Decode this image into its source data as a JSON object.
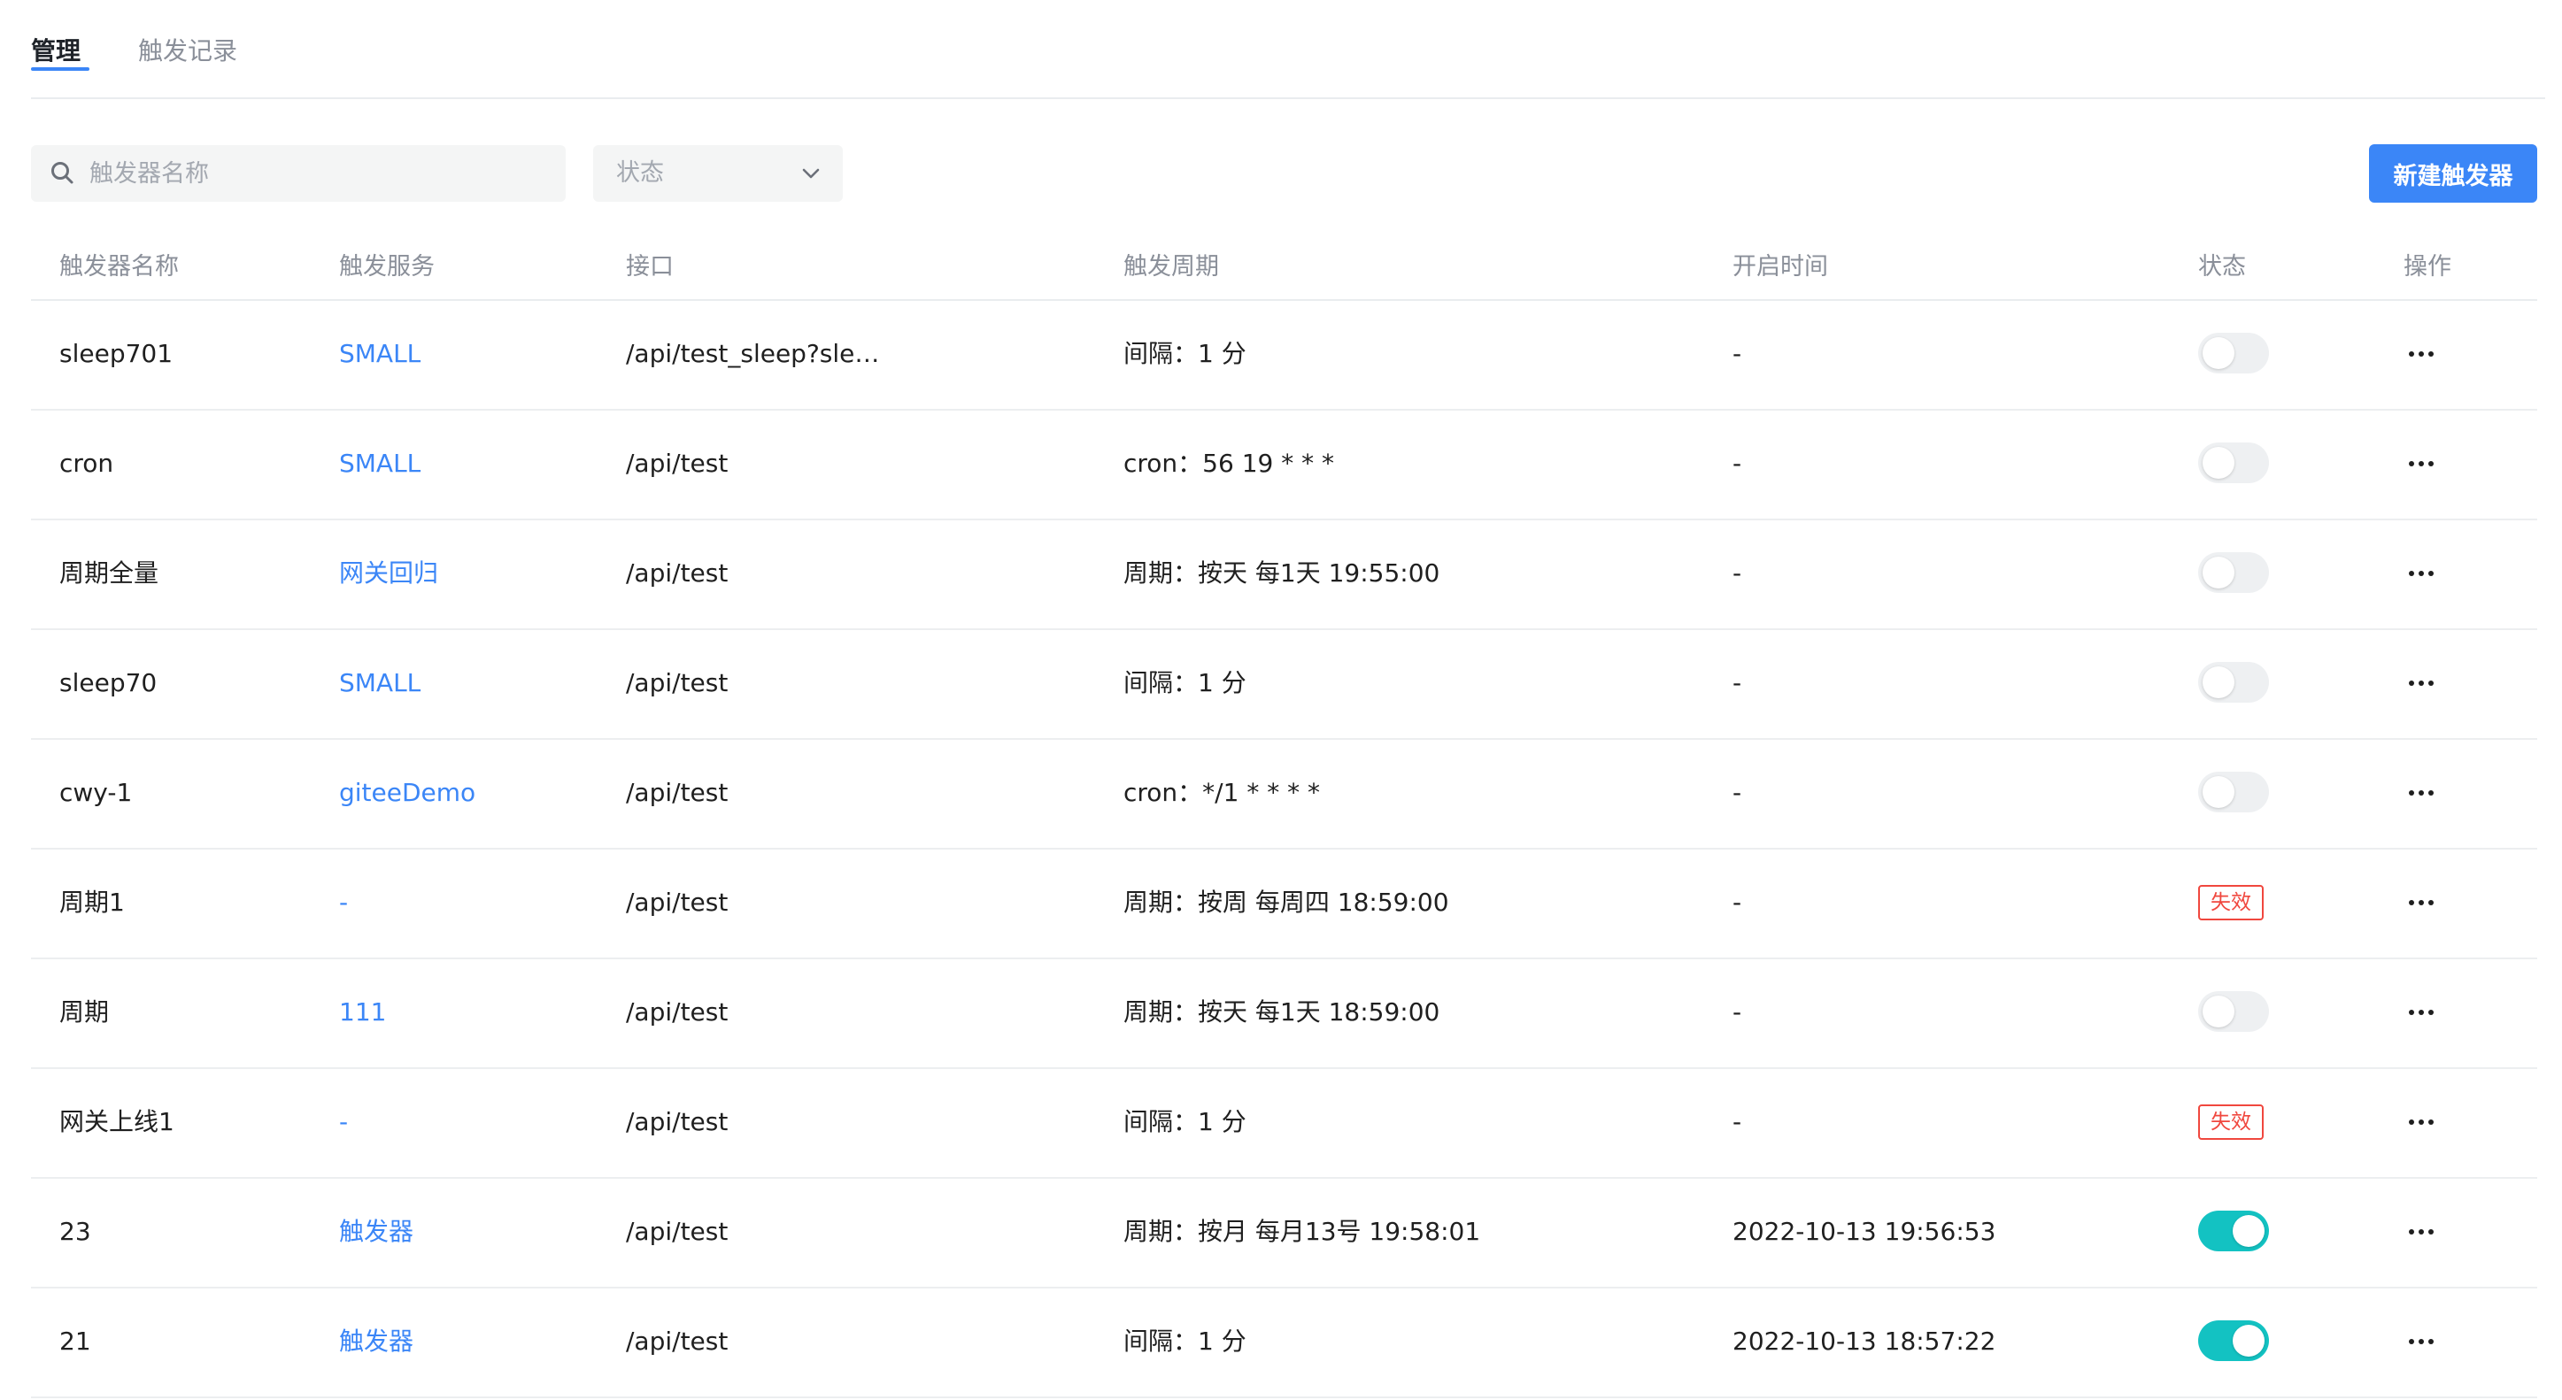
{
  "tabs": [
    {
      "label": "管理",
      "active": true
    },
    {
      "label": "触发记录",
      "active": false
    }
  ],
  "toolbar": {
    "search_placeholder": "触发器名称",
    "status_select_label": "状态",
    "new_button": "新建触发器"
  },
  "table": {
    "headers": [
      "触发器名称",
      "触发服务",
      "接口",
      "触发周期",
      "开启时间",
      "状态",
      "操作"
    ],
    "rows": [
      {
        "name": "sleep701",
        "service": "SMALL",
        "api": "/api/test_sleep?sleep...",
        "cycle": "间隔：1 分",
        "start_time": "-",
        "status": "off"
      },
      {
        "name": "cron",
        "service": "SMALL",
        "api": "/api/test",
        "cycle": "cron：56 19 * * *",
        "start_time": "-",
        "status": "off"
      },
      {
        "name": "周期全量",
        "service": "网关回归",
        "api": "/api/test",
        "cycle": "周期：按天 每1天 19:55:00",
        "start_time": "-",
        "status": "off"
      },
      {
        "name": "sleep70",
        "service": "SMALL",
        "api": "/api/test",
        "cycle": "间隔：1 分",
        "start_time": "-",
        "status": "off"
      },
      {
        "name": "cwy-1",
        "service": "giteeDemo",
        "api": "/api/test",
        "cycle": "cron：*/1 * * * *",
        "start_time": "-",
        "status": "off"
      },
      {
        "name": "周期1",
        "service": "-",
        "api": "/api/test",
        "cycle": "周期：按周 每周四 18:59:00",
        "start_time": "-",
        "status": "invalid"
      },
      {
        "name": "周期",
        "service": "111",
        "api": "/api/test",
        "cycle": "周期：按天 每1天 18:59:00",
        "start_time": "-",
        "status": "off"
      },
      {
        "name": "网关上线1",
        "service": "-",
        "api": "/api/test",
        "cycle": "间隔：1 分",
        "start_time": "-",
        "status": "invalid"
      },
      {
        "name": "23",
        "service": "触发器",
        "api": "/api/test",
        "cycle": "周期：按月 每月13号 19:58:01",
        "start_time": "2022-10-13 19:56:53",
        "status": "on"
      },
      {
        "name": "21",
        "service": "触发器",
        "api": "/api/test",
        "cycle": "间隔：1 分",
        "start_time": "2022-10-13 18:57:22",
        "status": "on"
      }
    ],
    "invalid_label": "失效"
  },
  "colors": {
    "accent": "#3b86f7",
    "switch_on": "#13c2c2",
    "invalid": "#f0473e"
  },
  "icons": {
    "search": "search-icon",
    "select": "chevron-down-icon",
    "row_action": "more-horizontal-icon"
  }
}
